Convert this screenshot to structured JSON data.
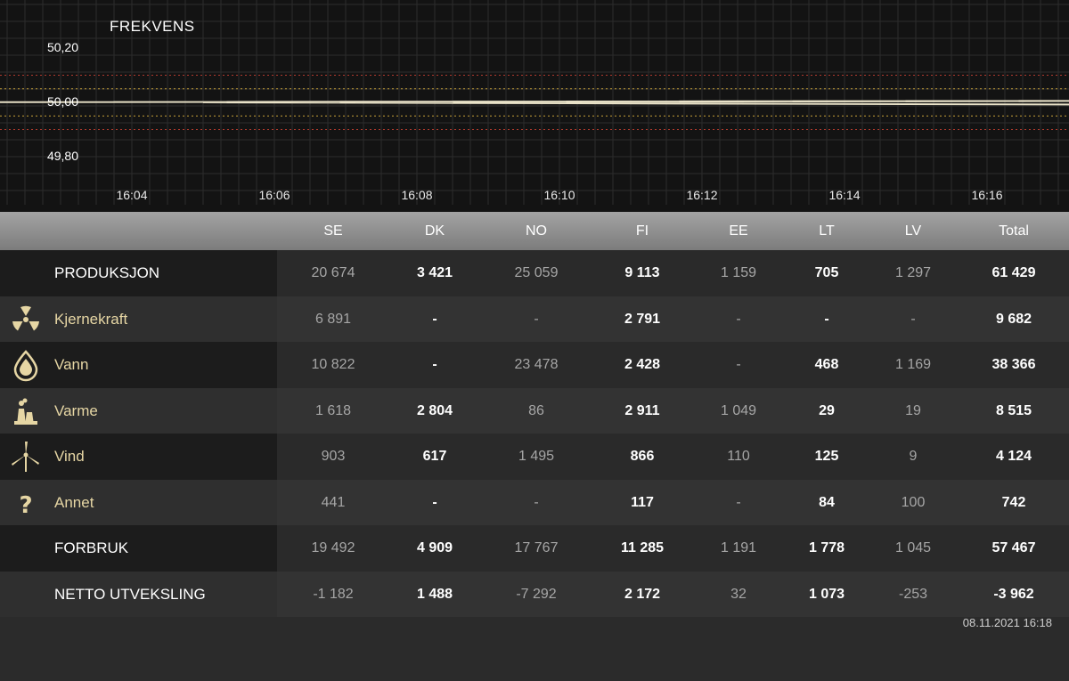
{
  "chart_data": {
    "type": "line",
    "title": "FREKVENS",
    "ylim": [
      49.75,
      50.25
    ],
    "y_ticks": [
      "50,20",
      "50,00",
      "49,80"
    ],
    "y_tick_values": [
      50.2,
      50.0,
      49.8
    ],
    "x_ticks": [
      "16:04",
      "16:06",
      "16:08",
      "16:10",
      "16:12",
      "16:14",
      "16:16"
    ],
    "xlim_minutes": [
      15.3,
      17.0
    ],
    "reference_lines": [
      {
        "value": 50.1,
        "color": "#b03a2e"
      },
      {
        "value": 50.05,
        "color": "#c8a23a"
      },
      {
        "value": 49.95,
        "color": "#c8a23a"
      },
      {
        "value": 49.9,
        "color": "#b03a2e"
      }
    ],
    "series": [
      {
        "color": "#e9e2c8",
        "x": [
          15.3,
          15.6,
          15.9,
          16.05,
          16.2,
          16.35,
          16.5,
          16.65,
          16.8,
          16.95,
          17.0
        ],
        "values": [
          50.0,
          50.0,
          50.01,
          50.0,
          49.99,
          50.0,
          50.01,
          50.0,
          49.99,
          49.99,
          49.98
        ]
      }
    ]
  },
  "table": {
    "columns": [
      "SE",
      "DK",
      "NO",
      "FI",
      "EE",
      "LT",
      "LV",
      "Total"
    ],
    "rows": [
      {
        "label": "PRODUKSJON",
        "icon": "",
        "kind": "heading",
        "values": [
          "20 674",
          "3 421",
          "25 059",
          "9 113",
          "1 159",
          "705",
          "1 297",
          "61 429"
        ]
      },
      {
        "label": "Kjernekraft",
        "icon": "nuclear-icon",
        "kind": "source",
        "values": [
          "6 891",
          "-",
          "-",
          "2 791",
          "-",
          "-",
          "-",
          "9 682"
        ]
      },
      {
        "label": "Vann",
        "icon": "water-drop-icon",
        "kind": "source",
        "values": [
          "10 822",
          "-",
          "23 478",
          "2 428",
          "-",
          "468",
          "1 169",
          "38 366"
        ]
      },
      {
        "label": "Varme",
        "icon": "power-plant-icon",
        "kind": "source",
        "values": [
          "1 618",
          "2 804",
          "86",
          "2 911",
          "1 049",
          "29",
          "19",
          "8 515"
        ]
      },
      {
        "label": "Vind",
        "icon": "wind-turbine-icon",
        "kind": "source",
        "values": [
          "903",
          "617",
          "1 495",
          "866",
          "110",
          "125",
          "9",
          "4 124"
        ]
      },
      {
        "label": "Annet",
        "icon": "question-mark-icon",
        "kind": "source",
        "values": [
          "441",
          "-",
          "-",
          "117",
          "-",
          "84",
          "100",
          "742"
        ]
      },
      {
        "label": "FORBRUK",
        "icon": "",
        "kind": "heading",
        "values": [
          "19 492",
          "4 909",
          "17 767",
          "11 285",
          "1 191",
          "1 778",
          "1 045",
          "57 467"
        ]
      },
      {
        "label": "NETTO UTVEKSLING",
        "icon": "",
        "kind": "heading",
        "values": [
          "-1 182",
          "1 488",
          "-7 292",
          "2 172",
          "32",
          "1 073",
          "-253",
          "-3 962"
        ]
      }
    ]
  },
  "timestamp": "08.11.2021 16:18",
  "colors": {
    "accent_gold": "#e6d6a4",
    "row_dark": "#1c1c1c",
    "row_light": "#2f2f2f"
  }
}
